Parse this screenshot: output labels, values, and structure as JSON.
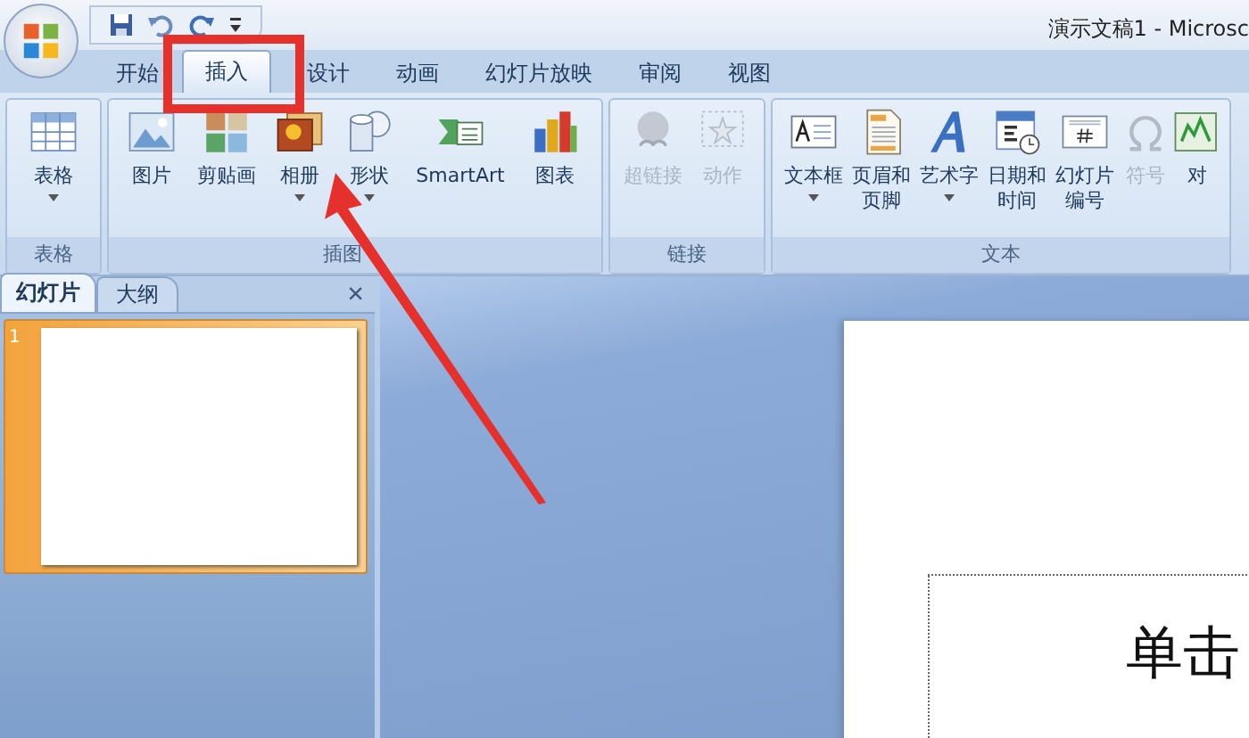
{
  "title_bar": {
    "title": "演示文稿1 - Microsc"
  },
  "tabs": [
    {
      "label": "开始",
      "selected": false
    },
    {
      "label": "插入",
      "selected": true
    },
    {
      "label": "设计",
      "selected": false
    },
    {
      "label": "动画",
      "selected": false
    },
    {
      "label": "幻灯片放映",
      "selected": false
    },
    {
      "label": "审阅",
      "selected": false
    },
    {
      "label": "视图",
      "selected": false
    }
  ],
  "ribbon": {
    "groups": [
      {
        "label": "表格",
        "buttons": [
          {
            "lines": [
              "表格"
            ],
            "dropdown": true,
            "disabled": false
          }
        ]
      },
      {
        "label": "插图",
        "buttons": [
          {
            "lines": [
              "图片"
            ],
            "dropdown": false,
            "disabled": false
          },
          {
            "lines": [
              "剪贴画"
            ],
            "dropdown": false,
            "disabled": false
          },
          {
            "lines": [
              "相册"
            ],
            "dropdown": true,
            "disabled": false
          },
          {
            "lines": [
              "形状"
            ],
            "dropdown": true,
            "disabled": false
          },
          {
            "lines": [
              "SmartArt"
            ],
            "dropdown": false,
            "disabled": false
          },
          {
            "lines": [
              "图表"
            ],
            "dropdown": false,
            "disabled": false
          }
        ]
      },
      {
        "label": "链接",
        "buttons": [
          {
            "lines": [
              "超链接"
            ],
            "dropdown": false,
            "disabled": true
          },
          {
            "lines": [
              "动作"
            ],
            "dropdown": false,
            "disabled": true
          }
        ]
      },
      {
        "label": "文本",
        "buttons": [
          {
            "lines": [
              "文本框"
            ],
            "dropdown": true,
            "disabled": false
          },
          {
            "lines": [
              "页眉和",
              "页脚"
            ],
            "dropdown": false,
            "disabled": false
          },
          {
            "lines": [
              "艺术字"
            ],
            "dropdown": true,
            "disabled": false
          },
          {
            "lines": [
              "日期和",
              "时间"
            ],
            "dropdown": false,
            "disabled": false
          },
          {
            "lines": [
              "幻灯片",
              "编号"
            ],
            "dropdown": false,
            "disabled": false
          },
          {
            "lines": [
              "符号"
            ],
            "dropdown": false,
            "disabled": true
          },
          {
            "lines": [
              "对"
            ],
            "dropdown": false,
            "disabled": false
          }
        ]
      }
    ]
  },
  "pane": {
    "tabs": [
      {
        "label": "幻灯片",
        "selected": true
      },
      {
        "label": "大纲",
        "selected": false
      }
    ],
    "close": "×",
    "slides": [
      {
        "number": "1",
        "selected": true
      }
    ]
  },
  "slide": {
    "placeholder_text": "单击"
  }
}
